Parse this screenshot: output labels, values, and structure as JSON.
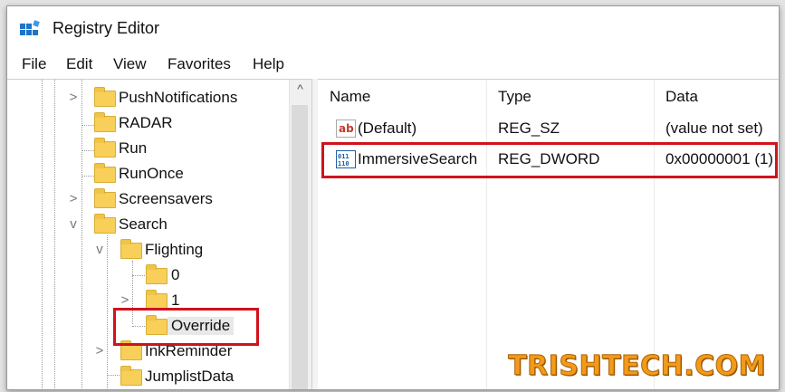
{
  "window": {
    "title": "Registry Editor"
  },
  "menu": [
    "File",
    "Edit",
    "View",
    "Favorites",
    "Help"
  ],
  "tree": {
    "items": [
      {
        "label": "PushNotifications",
        "expander": ">"
      },
      {
        "label": "RADAR",
        "expander": ""
      },
      {
        "label": "Run",
        "expander": ""
      },
      {
        "label": "RunOnce",
        "expander": ""
      },
      {
        "label": "Screensavers",
        "expander": ">"
      },
      {
        "label": "Search",
        "expander": "v"
      },
      {
        "label": "Flighting",
        "expander": "v"
      },
      {
        "label": "0",
        "expander": ""
      },
      {
        "label": "1",
        "expander": ">"
      },
      {
        "label": "Override",
        "expander": "",
        "selected": true
      },
      {
        "label": "InkReminder",
        "expander": ">"
      },
      {
        "label": "JumplistData",
        "expander": ""
      }
    ],
    "scroll_up": "^"
  },
  "values": {
    "headers": {
      "name": "Name",
      "type": "Type",
      "data": "Data"
    },
    "rows": [
      {
        "name": "(Default)",
        "type": "REG_SZ",
        "data": "(value not set)",
        "icon": "string-value-icon",
        "icon_text": "ab"
      },
      {
        "name": "ImmersiveSearch",
        "type": "REG_DWORD",
        "data": "0x00000001 (1)",
        "icon": "dword-value-icon",
        "icon_text": "011"
      }
    ]
  },
  "watermark": "TRISHTECH.COM",
  "colors": {
    "highlight": "#d0121b",
    "folder": "#f7cf59",
    "watermark": "#f29a1a"
  }
}
